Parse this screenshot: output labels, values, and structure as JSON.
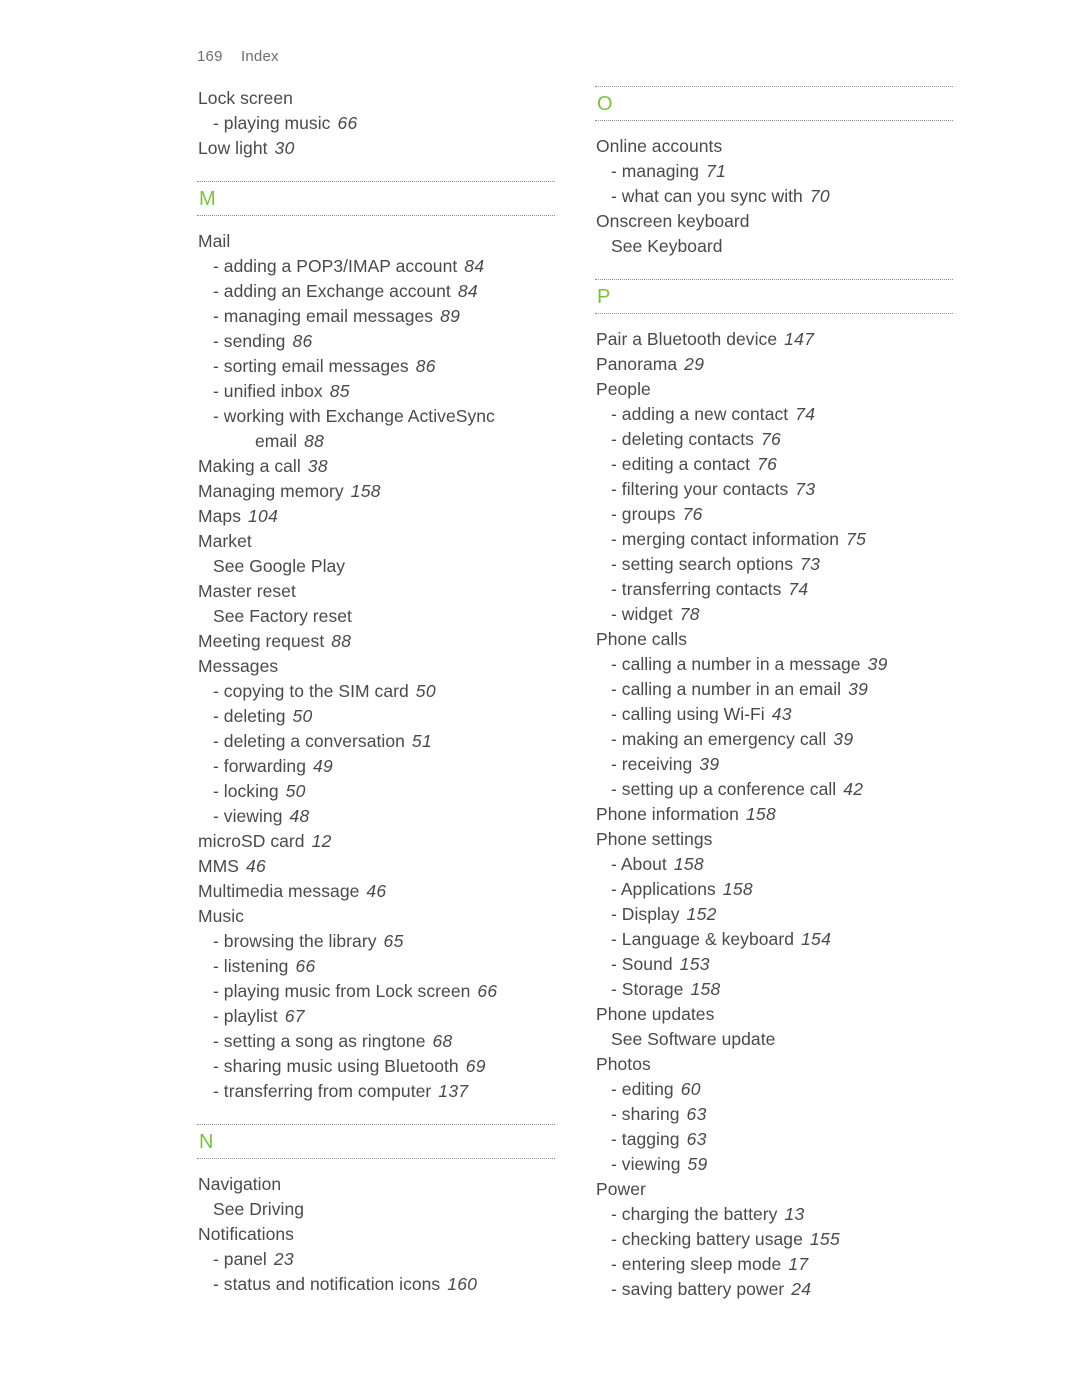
{
  "header": {
    "folio": "169",
    "section": "Index"
  },
  "colors": {
    "letter_green": "#7cc242",
    "text": "#4a4a4a",
    "header_text": "#6e6e6e",
    "rule": "#8c8c8c",
    "background": "#ffffff"
  },
  "columns": [
    {
      "id": "left-column",
      "blocks": [
        {
          "type": "entries",
          "entries": [
            {
              "level": 0,
              "label": "Lock screen",
              "page": ""
            },
            {
              "level": 1,
              "label": "- playing music",
              "page": "66"
            },
            {
              "level": 0,
              "label": "Low light",
              "page": "30"
            }
          ]
        },
        {
          "type": "letter",
          "letter": "M"
        },
        {
          "type": "entries",
          "entries": [
            {
              "level": 0,
              "label": "Mail",
              "page": ""
            },
            {
              "level": 1,
              "label": "- adding a POP3/IMAP account",
              "page": "84"
            },
            {
              "level": 1,
              "label": "- adding an Exchange account",
              "page": "84"
            },
            {
              "level": 1,
              "label": "- managing email messages",
              "page": "89"
            },
            {
              "level": 1,
              "label": "- sending",
              "page": "86"
            },
            {
              "level": 1,
              "label": "- sorting email messages",
              "page": "86"
            },
            {
              "level": 1,
              "label": "- unified inbox",
              "page": "85"
            },
            {
              "level": 1,
              "label": "- working with Exchange ActiveSync",
              "page": ""
            },
            {
              "level": 2,
              "label": "email",
              "page": "88"
            },
            {
              "level": 0,
              "label": "Making a call",
              "page": "38"
            },
            {
              "level": 0,
              "label": "Managing memory",
              "page": "158"
            },
            {
              "level": 0,
              "label": "Maps",
              "page": "104"
            },
            {
              "level": 0,
              "label": "Market",
              "page": ""
            },
            {
              "level": 3,
              "label": "See Google Play",
              "page": ""
            },
            {
              "level": 0,
              "label": "Master reset",
              "page": ""
            },
            {
              "level": 3,
              "label": "See Factory reset",
              "page": ""
            },
            {
              "level": 0,
              "label": "Meeting request",
              "page": "88"
            },
            {
              "level": 0,
              "label": "Messages",
              "page": ""
            },
            {
              "level": 1,
              "label": "- copying to the SIM card",
              "page": "50"
            },
            {
              "level": 1,
              "label": "- deleting",
              "page": "50"
            },
            {
              "level": 1,
              "label": "- deleting a conversation",
              "page": "51"
            },
            {
              "level": 1,
              "label": "- forwarding",
              "page": "49"
            },
            {
              "level": 1,
              "label": "- locking",
              "page": "50"
            },
            {
              "level": 1,
              "label": "- viewing",
              "page": "48"
            },
            {
              "level": 0,
              "label": "microSD card",
              "page": "12"
            },
            {
              "level": 0,
              "label": "MMS",
              "page": "46"
            },
            {
              "level": 0,
              "label": "Multimedia message",
              "page": "46"
            },
            {
              "level": 0,
              "label": "Music",
              "page": ""
            },
            {
              "level": 1,
              "label": "- browsing the library",
              "page": "65"
            },
            {
              "level": 1,
              "label": "- listening",
              "page": "66"
            },
            {
              "level": 1,
              "label": "- playing music from Lock screen",
              "page": "66"
            },
            {
              "level": 1,
              "label": "- playlist",
              "page": "67"
            },
            {
              "level": 1,
              "label": "- setting a song as ringtone",
              "page": "68"
            },
            {
              "level": 1,
              "label": "- sharing music using Bluetooth",
              "page": "69"
            },
            {
              "level": 1,
              "label": "- transferring from computer",
              "page": "137"
            }
          ]
        },
        {
          "type": "letter",
          "letter": "N"
        },
        {
          "type": "entries",
          "entries": [
            {
              "level": 0,
              "label": "Navigation",
              "page": ""
            },
            {
              "level": 3,
              "label": "See Driving",
              "page": ""
            },
            {
              "level": 0,
              "label": "Notifications",
              "page": ""
            },
            {
              "level": 1,
              "label": "- panel",
              "page": "23"
            },
            {
              "level": 1,
              "label": "- status and notification icons",
              "page": "160"
            }
          ]
        }
      ]
    },
    {
      "id": "right-column",
      "blocks": [
        {
          "type": "letter",
          "letter": "O"
        },
        {
          "type": "entries",
          "entries": [
            {
              "level": 0,
              "label": "Online accounts",
              "page": ""
            },
            {
              "level": 1,
              "label": "- managing",
              "page": "71"
            },
            {
              "level": 1,
              "label": "- what can you sync with",
              "page": "70"
            },
            {
              "level": 0,
              "label": "Onscreen keyboard",
              "page": ""
            },
            {
              "level": 3,
              "label": "See Keyboard",
              "page": ""
            }
          ]
        },
        {
          "type": "letter",
          "letter": "P"
        },
        {
          "type": "entries",
          "entries": [
            {
              "level": 0,
              "label": "Pair a Bluetooth device",
              "page": "147"
            },
            {
              "level": 0,
              "label": "Panorama",
              "page": "29"
            },
            {
              "level": 0,
              "label": "People",
              "page": ""
            },
            {
              "level": 1,
              "label": "- adding a new contact",
              "page": "74"
            },
            {
              "level": 1,
              "label": "- deleting contacts",
              "page": "76"
            },
            {
              "level": 1,
              "label": "- editing a contact",
              "page": "76"
            },
            {
              "level": 1,
              "label": "- filtering your contacts",
              "page": "73"
            },
            {
              "level": 1,
              "label": "- groups",
              "page": "76"
            },
            {
              "level": 1,
              "label": "- merging contact information",
              "page": "75"
            },
            {
              "level": 1,
              "label": "- setting search options",
              "page": "73"
            },
            {
              "level": 1,
              "label": "- transferring contacts",
              "page": "74"
            },
            {
              "level": 1,
              "label": "- widget",
              "page": "78"
            },
            {
              "level": 0,
              "label": "Phone calls",
              "page": ""
            },
            {
              "level": 1,
              "label": "- calling a number in a message",
              "page": "39"
            },
            {
              "level": 1,
              "label": "- calling a number in an email",
              "page": "39"
            },
            {
              "level": 1,
              "label": "- calling using Wi-Fi",
              "page": "43"
            },
            {
              "level": 1,
              "label": "- making an emergency call",
              "page": "39"
            },
            {
              "level": 1,
              "label": "- receiving",
              "page": "39"
            },
            {
              "level": 1,
              "label": "- setting up a conference call",
              "page": "42"
            },
            {
              "level": 0,
              "label": "Phone information",
              "page": "158"
            },
            {
              "level": 0,
              "label": "Phone settings",
              "page": ""
            },
            {
              "level": 1,
              "label": "- About",
              "page": "158"
            },
            {
              "level": 1,
              "label": "- Applications",
              "page": "158"
            },
            {
              "level": 1,
              "label": "- Display",
              "page": "152"
            },
            {
              "level": 1,
              "label": "- Language & keyboard",
              "page": "154"
            },
            {
              "level": 1,
              "label": "- Sound",
              "page": "153"
            },
            {
              "level": 1,
              "label": "- Storage",
              "page": "158"
            },
            {
              "level": 0,
              "label": "Phone updates",
              "page": ""
            },
            {
              "level": 3,
              "label": "See Software update",
              "page": ""
            },
            {
              "level": 0,
              "label": "Photos",
              "page": ""
            },
            {
              "level": 1,
              "label": "- editing",
              "page": "60"
            },
            {
              "level": 1,
              "label": "- sharing",
              "page": "63"
            },
            {
              "level": 1,
              "label": "- tagging",
              "page": "63"
            },
            {
              "level": 1,
              "label": "- viewing",
              "page": "59"
            },
            {
              "level": 0,
              "label": "Power",
              "page": ""
            },
            {
              "level": 1,
              "label": "- charging the battery",
              "page": "13"
            },
            {
              "level": 1,
              "label": "- checking battery usage",
              "page": "155"
            },
            {
              "level": 1,
              "label": "- entering sleep mode",
              "page": "17"
            },
            {
              "level": 1,
              "label": "- saving battery power",
              "page": "24"
            }
          ]
        }
      ]
    }
  ]
}
